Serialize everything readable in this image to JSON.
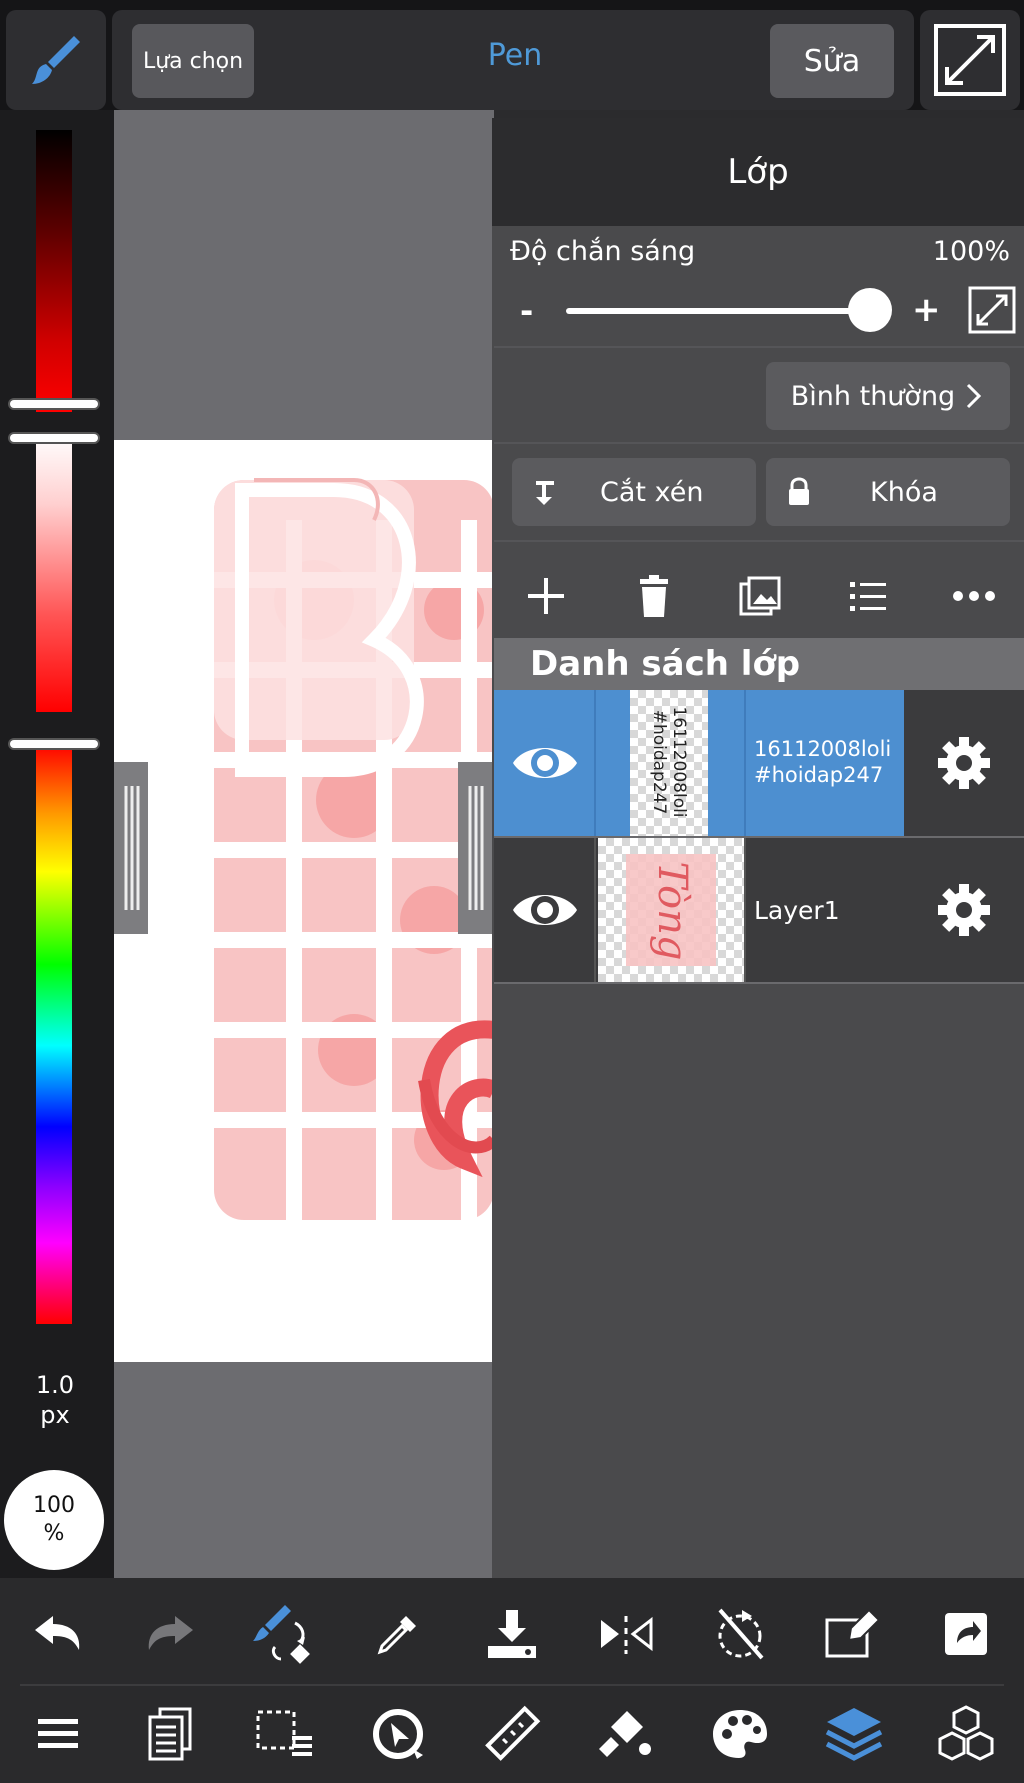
{
  "top_bar": {
    "select_label": "Lựa chọn",
    "tool_title": "Pen",
    "edit_label": "Sửa"
  },
  "left_panel": {
    "brush_size_value": "1.0",
    "brush_size_unit": "px",
    "opacity_value": "100",
    "opacity_unit": "%"
  },
  "layer_panel": {
    "title": "Lớp",
    "opacity_label": "Độ chắn sáng",
    "opacity_value": "100%",
    "opacity_level": 1.0,
    "minus_label": "-",
    "plus_label": "+",
    "blend_mode": "Bình thường",
    "clip_label": "Cắt xén",
    "lock_label": "Khóa",
    "list_title": "Danh sách lớp",
    "layers": [
      {
        "name": "16112008loli\n#hoidap247",
        "thumb_text": "16112008loli\n#hoidap247",
        "selected": true,
        "visible": true
      },
      {
        "name": "Layer1",
        "thumb_text": "Tòng",
        "selected": false,
        "visible": true
      }
    ]
  },
  "colors": {
    "accent": "#4a90d9",
    "selected_layer": "#4d8fd0",
    "panel_bg": "#4a4a4c"
  },
  "icons": {
    "top": [
      "brush-icon",
      "fullscreen-icon"
    ],
    "toolbar_row1": [
      "undo-icon",
      "redo-icon",
      "brush-swap-icon",
      "eyedropper-icon",
      "save-icon",
      "flip-icon",
      "rotate-off-icon",
      "edit-icon",
      "export-icon"
    ],
    "toolbar_row2": [
      "menu-icon",
      "pages-icon",
      "selection-icon",
      "transform-icon",
      "ruler-icon",
      "fill-icon",
      "palette-icon",
      "layers-icon",
      "materials-icon"
    ]
  }
}
